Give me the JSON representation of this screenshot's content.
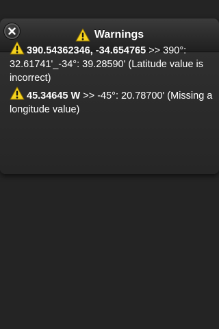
{
  "header": {
    "title": "Warnings",
    "icon": "warning-icon",
    "close_icon": "close-icon"
  },
  "warnings": [
    {
      "input": "390.54362346, -34.654765",
      "arrow": ">>",
      "message": "390°: 32.61741'_-34°: 39.28590' (Latitude value is incorrect)"
    },
    {
      "input": "45.34645 W",
      "arrow": ">>",
      "message": "-45°: 20.78700' (Missing a longitude value)"
    }
  ],
  "colors": {
    "background": "#242424",
    "warning_yellow": "#f4d21e"
  }
}
